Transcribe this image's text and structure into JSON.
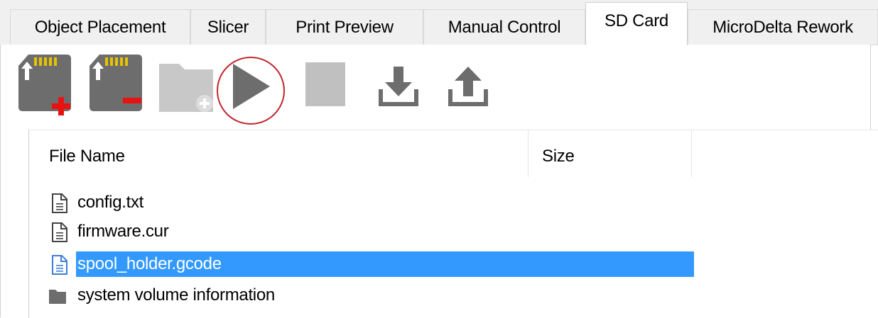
{
  "tabs": [
    {
      "label": "Object Placement",
      "active": false
    },
    {
      "label": "Slicer",
      "active": false
    },
    {
      "label": "Print Preview",
      "active": false
    },
    {
      "label": "Manual Control",
      "active": false
    },
    {
      "label": "SD Card",
      "active": true
    },
    {
      "label": "MicroDelta Rework",
      "active": false
    }
  ],
  "toolbar": {
    "buttons": [
      {
        "icon": "sd-card-add-icon",
        "enabled": true
      },
      {
        "icon": "sd-card-remove-icon",
        "enabled": true
      },
      {
        "icon": "new-folder-icon",
        "enabled": false
      },
      {
        "icon": "play-icon",
        "enabled": true,
        "highlighted": true
      },
      {
        "icon": "stop-icon",
        "enabled": false
      },
      {
        "icon": "download-icon",
        "enabled": true
      },
      {
        "icon": "upload-icon",
        "enabled": true
      }
    ],
    "colors": {
      "icon_gray": "#6d6d6d",
      "disabled_gray": "#c0c0c0",
      "plus_red": "#e81212",
      "highlight_ring": "#c1272d"
    }
  },
  "file_list": {
    "columns": [
      "File Name",
      "Size"
    ],
    "rows": [
      {
        "name": "config.txt",
        "icon": "file-icon",
        "selected": false
      },
      {
        "name": "firmware.cur",
        "icon": "file-icon",
        "selected": false
      },
      {
        "name": "spool_holder.gcode",
        "icon": "file-icon",
        "selected": true
      },
      {
        "name": "system volume information",
        "icon": "folder-icon",
        "selected": false
      }
    ],
    "selection_color": "#3399ff"
  }
}
